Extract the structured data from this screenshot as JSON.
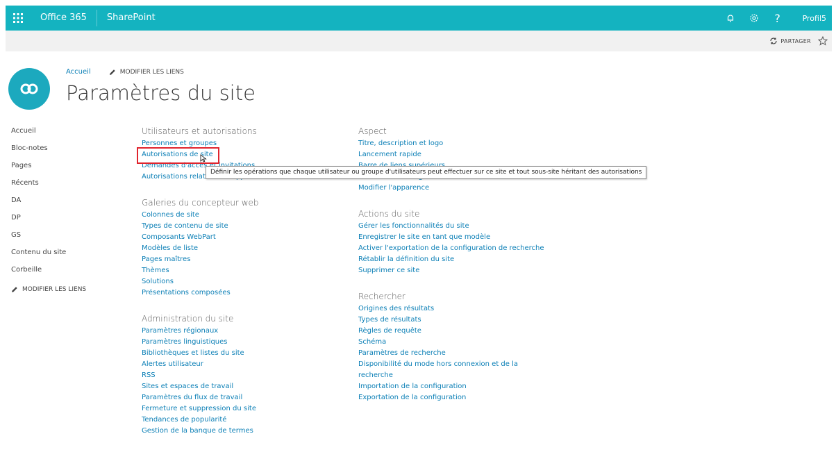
{
  "suitebar": {
    "app_launcher_icon": "waffle-icon",
    "office_label": "Office 365",
    "app_label": "SharePoint",
    "profile_label": "Profil5",
    "help_label": "?",
    "bg_color": "#14b3c0"
  },
  "commandbar": {
    "share_label": "PARTAGER"
  },
  "header": {
    "breadcrumb_home": "Accueil",
    "edit_links": "MODIFIER LES LIENS",
    "title": "Paramètres du site"
  },
  "leftnav": {
    "items": [
      "Accueil",
      "Bloc-notes",
      "Pages",
      "Récents",
      "DA",
      "DP",
      "GS",
      "Contenu du site",
      "Corbeille"
    ],
    "edit_links": "MODIFIER LES LIENS"
  },
  "sections": {
    "users": {
      "title": "Utilisateurs et autorisations",
      "links": [
        "Personnes et groupes",
        "Autorisations de site",
        "Demandes d'accès et invitations",
        "Autorisations relatives à l'application du site"
      ]
    },
    "web_designer": {
      "title": "Galeries du concepteur web",
      "links": [
        "Colonnes de site",
        "Types de contenu de site",
        "Composants WebPart",
        "Modèles de liste",
        "Pages maîtres",
        "Thèmes",
        "Solutions",
        "Présentations composées"
      ]
    },
    "admin": {
      "title": "Administration du site",
      "links": [
        "Paramètres régionaux",
        "Paramètres linguistiques",
        "Bibliothèques et listes du site",
        "Alertes utilisateur",
        "RSS",
        "Sites et espaces de travail",
        "Paramètres du flux de travail",
        "Fermeture et suppression du site",
        "Tendances de popularité",
        "Gestion de la banque de termes"
      ]
    },
    "look": {
      "title": "Aspect",
      "links": [
        "Titre, description et logo",
        "Lancement rapide",
        "Barre de liens supérieurs",
        "Éléments de navigation",
        "Modifier l'apparence"
      ]
    },
    "actions": {
      "title": "Actions du site",
      "links": [
        "Gérer les fonctionnalités du site",
        "Enregistrer le site en tant que modèle",
        "Activer l'exportation de la configuration de recherche",
        "Rétablir la définition du site",
        "Supprimer ce site"
      ]
    },
    "search": {
      "title": "Rechercher",
      "links": [
        "Origines des résultats",
        "Types de résultats",
        "Règles de requête",
        "Schéma",
        "Paramètres de recherche",
        "Disponibilité du mode hors connexion et de la recherche",
        "Importation de la configuration",
        "Exportation de la configuration"
      ]
    }
  },
  "tooltip": {
    "text": "Définir les opérations que chaque utilisateur ou groupe d'utilisateurs peut effectuer sur ce site et tout sous-site héritant des autorisations"
  },
  "colors": {
    "link": "#0b7fb6",
    "highlight": "#e0242d",
    "logo": "#1ca9be"
  }
}
